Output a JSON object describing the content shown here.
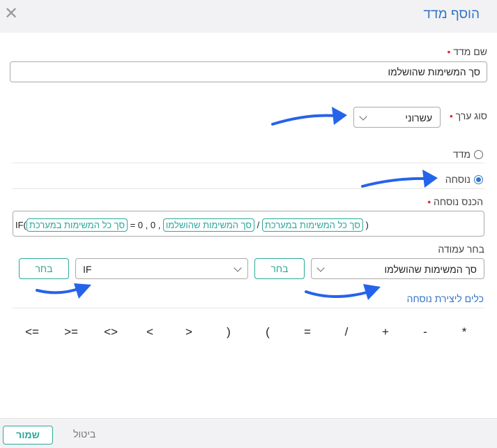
{
  "dialog": {
    "title": "הוסף מדד",
    "close_symbol": "✕"
  },
  "measure_name": {
    "label": "שם מדד",
    "value": "סך המשימות שהושלמו"
  },
  "value_type": {
    "label": "סוג ערך",
    "selected": "עשרוני"
  },
  "mode": {
    "option_measure": "מדד",
    "option_formula": "נוסחה",
    "selected": "נוסחה"
  },
  "formula": {
    "label": "הכנס נוסחה",
    "parts": [
      {
        "kind": "text",
        "text": "IF("
      },
      {
        "kind": "chip",
        "text": "סך כל המשימות במערכת"
      },
      {
        "kind": "text",
        "text": " = 0 , 0 , "
      },
      {
        "kind": "chip",
        "text": "סך המשימות שהושלמו"
      },
      {
        "kind": "text",
        "text": " / "
      },
      {
        "kind": "chip",
        "text": "סך כל המשימות במערכת"
      },
      {
        "kind": "text",
        "text": " )"
      }
    ]
  },
  "column_picker": {
    "label": "בחר עמודה",
    "column_selected": "סך המשימות שהושלמו",
    "column_button": "בחר",
    "function_selected": "IF",
    "function_button": "בחר"
  },
  "tools": {
    "link_label": "כלים ליצירת נוסחה",
    "operators": [
      "*",
      "-",
      "+",
      "/",
      "=",
      "(",
      ")",
      ">",
      "<",
      "<>",
      ">=",
      "<="
    ]
  },
  "footer": {
    "save_label": "שמור",
    "cancel_label": "ביטול"
  },
  "colors": {
    "accent_blue": "#3474c8",
    "teal": "#2ba89a",
    "required": "#e0293a",
    "annotation_arrow": "#2563eb"
  }
}
